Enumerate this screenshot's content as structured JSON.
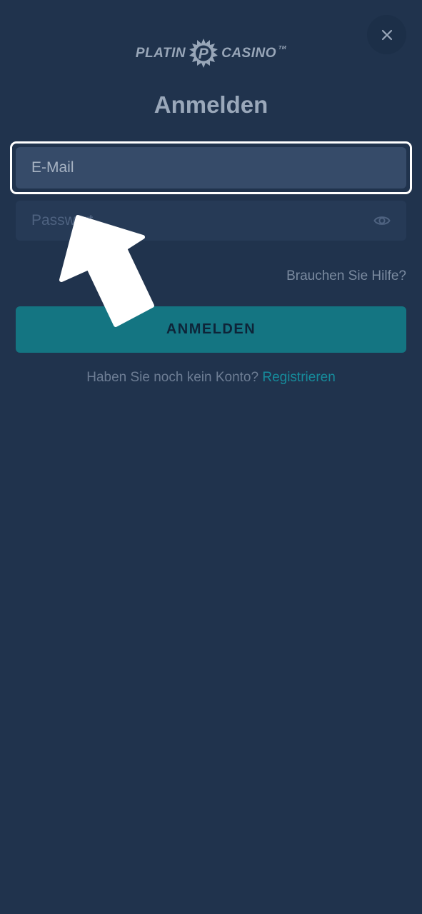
{
  "header": {
    "logo_left": "PLATIN",
    "logo_right": "CASINO",
    "logo_tm": "TM",
    "close_icon": "close-icon"
  },
  "login": {
    "title": "Anmelden",
    "email_placeholder": "E-Mail",
    "password_placeholder": "Passwort",
    "password_toggle_icon": "eye-icon",
    "help_link": "Brauchen Sie Hilfe?",
    "submit_label": "ANMELDEN",
    "no_account_text": "Haben Sie noch kein Konto?",
    "register_link": "Registrieren"
  },
  "colors": {
    "background": "#20334d",
    "accent": "#147582",
    "link": "#168c9c"
  }
}
